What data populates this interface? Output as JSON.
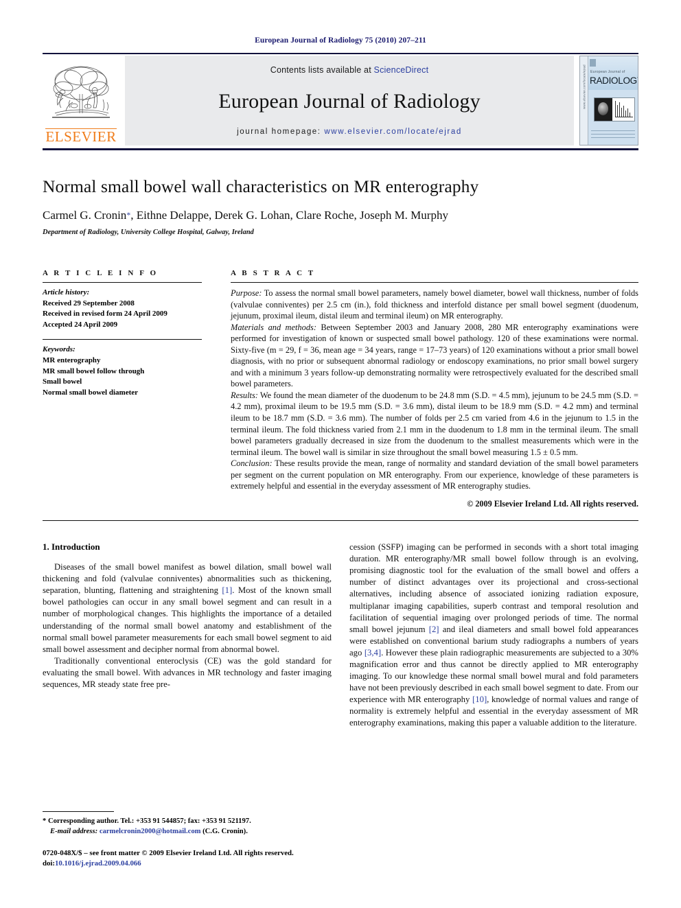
{
  "running_head": "European Journal of Radiology 75 (2010) 207–211",
  "masthead": {
    "publisher_name": "ELSEVIER",
    "contents_prefix": "Contents lists available at ",
    "contents_link": "ScienceDirect",
    "journal_name": "European Journal of Radiology",
    "homepage_prefix": "journal homepage: ",
    "homepage_url": "www.elsevier.com/locate/ejrad",
    "cover": {
      "kicker": "European Journal of",
      "title": "RADIOLOGY",
      "spine_text": "www.elsevier.com/locate/ejrad"
    }
  },
  "article": {
    "title": "Normal small bowel wall characteristics on MR enterography",
    "authors": "Carmel G. Cronin",
    "corresponding_marker": "*",
    "authors_rest": ", Eithne Delappe, Derek G. Lohan, Clare Roche, Joseph M. Murphy",
    "affiliation": "Department of Radiology, University College Hospital, Galway, Ireland"
  },
  "article_info": {
    "heading": "A R T I C L E    I N F O",
    "history_label": "Article history:",
    "history": [
      "Received 29 September 2008",
      "Received in revised form 24 April 2009",
      "Accepted 24 April 2009"
    ],
    "keywords_label": "Keywords:",
    "keywords": [
      "MR enterography",
      "MR small bowel follow through",
      "Small bowel",
      "Normal small bowel diameter"
    ]
  },
  "abstract": {
    "heading": "A B S T R A C T",
    "purpose_label": "Purpose:",
    "purpose_text": " To assess the normal small bowel parameters, namely bowel diameter, bowel wall thickness, number of folds (valvulae conniventes) per 2.5 cm (in.), fold thickness and interfold distance per small bowel segment (duodenum, jejunum, proximal ileum, distal ileum and terminal ileum) on MR enterography.",
    "methods_label": "Materials and methods:",
    "methods_text": " Between September 2003 and January 2008, 280 MR enterography examinations were performed for investigation of known or suspected small bowel pathology. 120 of these examinations were normal. Sixty-five (m = 29, f = 36, mean age = 34 years, range = 17–73 years) of 120 examinations without a prior small bowel diagnosis, with no prior or subsequent abnormal radiology or endoscopy examinations, no prior small bowel surgery and with a minimum 3 years follow-up demonstrating normality were retrospectively evaluated for the described small bowel parameters.",
    "results_label": "Results:",
    "results_text": " We found the mean diameter of the duodenum to be 24.8 mm (S.D. = 4.5 mm), jejunum to be 24.5 mm (S.D. = 4.2 mm), proximal ileum to be 19.5 mm (S.D. = 3.6 mm), distal ileum to be 18.9 mm (S.D. = 4.2 mm) and terminal ileum to be 18.7 mm (S.D. = 3.6 mm). The number of folds per 2.5 cm varied from 4.6 in the jejunum to 1.5 in the terminal ileum. The fold thickness varied from 2.1 mm in the duodenum to 1.8 mm in the terminal ileum. The small bowel parameters gradually decreased in size from the duodenum to the smallest measurements which were in the terminal ileum. The bowel wall is similar in size throughout the small bowel measuring 1.5 ± 0.5 mm.",
    "conclusion_label": "Conclusion:",
    "conclusion_text": " These results provide the mean, range of normality and standard deviation of the small bowel parameters per segment on the current population on MR enterography. From our experience, knowledge of these parameters is extremely helpful and essential in the everyday assessment of MR enterography studies.",
    "copyright": "© 2009 Elsevier Ireland Ltd. All rights reserved."
  },
  "introduction": {
    "heading": "1.  Introduction",
    "p1_a": "Diseases of the small bowel manifest as bowel dilation, small bowel wall thickening and fold (valvulae conniventes) abnormalities such as thickening, separation, blunting, flattening and straightening ",
    "p1_ref": "[1]",
    "p1_b": ". Most of the known small bowel pathologies can occur in any small bowel segment and can result in a number of morphological changes. This highlights the importance of a detailed understanding of the normal small bowel anatomy and establishment of the normal small bowel parameter measurements for each small bowel segment to aid small bowel assessment and decipher normal from abnormal bowel.",
    "p2": "Traditionally conventional enteroclysis (CE) was the gold standard for evaluating the small bowel. With advances in MR technology and faster imaging sequences, MR steady state free pre-",
    "p3_a": "cession (SSFP) imaging can be performed in seconds with a short total imaging duration. MR enterography/MR small bowel follow through is an evolving, promising diagnostic tool for the evaluation of the small bowel and offers a number of distinct advantages over its projectional and cross-sectional alternatives, including absence of associated ionizing radiation exposure, multiplanar imaging capabilities, superb contrast and temporal resolution and facilitation of sequential imaging over prolonged periods of time. The normal small bowel jejunum ",
    "p3_ref1": "[2]",
    "p3_b": " and ileal diameters and small bowel fold appearances were established on conventional barium study radiographs a numbers of years ago ",
    "p3_ref2": "[3,4]",
    "p3_c": ". However these plain radiographic measurements are subjected to a 30% magnification error and thus cannot be directly applied to MR enterography imaging. To our knowledge these normal small bowel mural and fold parameters have not been previously described in each small bowel segment to date. From our experience with MR enterography ",
    "p3_ref3": "[10]",
    "p3_d": ", knowledge of normal values and range of normality is extremely helpful and essential in the everyday assessment of MR enterography examinations, making this paper a valuable addition to the literature."
  },
  "footnotes": {
    "corresponding": "* Corresponding author. Tel.: +353 91 544857; fax: +353 91 521197.",
    "email_label": "E-mail address:",
    "email": "carmelcronin2000@hotmail.com",
    "email_suffix": " (C.G. Cronin).",
    "issn_line": "0720-048X/$ – see front matter © 2009 Elsevier Ireland Ltd. All rights reserved.",
    "doi_label": "doi:",
    "doi": "10.1016/j.ejrad.2009.04.066"
  },
  "colors": {
    "link": "#2b3fa0",
    "elsevier_orange": "#f07c1a",
    "rule_navy": "#12123c",
    "banner_grey": "#e9eaec"
  }
}
